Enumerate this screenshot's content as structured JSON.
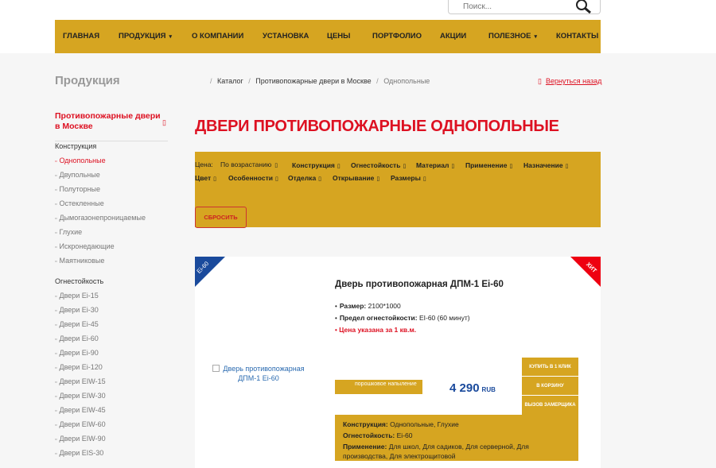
{
  "search": {
    "placeholder": "Поиск..."
  },
  "nav": {
    "items": [
      {
        "label": "ГЛАВНАЯ"
      },
      {
        "label": "ПРОДУКЦИЯ"
      },
      {
        "label": "О КОМПАНИИ"
      },
      {
        "label": "УСТАНОВКА"
      },
      {
        "label": "ЦЕНЫ"
      },
      {
        "label": "ПОРТФОЛИО"
      },
      {
        "label": "АКЦИИ"
      },
      {
        "label": "ПОЛЕЗНОЕ"
      },
      {
        "label": "КОНТАКТЫ"
      }
    ]
  },
  "sidebar": {
    "title": "Продукция",
    "category": "Противопожарные двери в Москве",
    "groups": [
      {
        "title": "Конструкция",
        "items": [
          "Однопольные",
          "Двупольные",
          "Полуторные",
          "Остекленные",
          "Дымогазонепроницаемые",
          "Глухие",
          "Искронедающие",
          "Маятниковые"
        ]
      },
      {
        "title": "Огнестойкость",
        "items": [
          "Двери Ei-15",
          "Двери Ei-30",
          "Двери Ei-45",
          "Двери Ei-60",
          "Двери Ei-90",
          "Двери Ei-120",
          "Двери EIW-15",
          "Двери EIW-30",
          "Двери EIW-45",
          "Двери EIW-60",
          "Двери EIW-90",
          "Двери EIS-30"
        ]
      }
    ]
  },
  "breadcrumb": {
    "items": [
      "Каталог",
      "Противопожарные двери в Москве",
      "Однопольные"
    ]
  },
  "back_link": "Вернуться назад",
  "heading": "ДВЕРИ ПРОТИВОПОЖАРНЫЕ ОДНОПОЛЬНЫЕ",
  "filter": {
    "price_label": "Цена:",
    "price_value": "По возрастанию",
    "row1": [
      "Конструкция",
      "Огнестойкость",
      "Материал",
      "Применение",
      "Назначение"
    ],
    "row2": [
      "Цвет",
      "Особенности",
      "Отделка",
      "Открывание",
      "Размеры"
    ],
    "reset": "СБРОСИТЬ"
  },
  "product": {
    "badge_left": "Ei-60",
    "badge_right": "ХИТ",
    "image_alt": "Дверь противопожарная ДПМ-1 Ei-60",
    "title": "Дверь противопожарная ДПМ-1 Ei-60",
    "specs": [
      {
        "label": "Размер:",
        "value": "2100*1000"
      },
      {
        "label": "Предел огнестойкости:",
        "value": "EI-60 (60 минут)"
      }
    ],
    "price_note": "Цена указана за 1 кв.м.",
    "coating": "порошковое напыление",
    "price": "4 290",
    "currency": "RUB",
    "buttons": [
      "КУПИТЬ В 1 КЛИК",
      "В КОРЗИНУ",
      "ВЫЗОВ ЗАМЕРЩИКА"
    ],
    "props": [
      {
        "k": "Конструкция:",
        "v": "Однопольные, Глухие"
      },
      {
        "k": "Огнестойкость:",
        "v": "Ei-60"
      },
      {
        "k": "Применение:",
        "v": "Для школ, Для садиков, Для серверной, Для производства, Для электрощитовой"
      }
    ]
  },
  "colors": {
    "accent": "#d6a521",
    "red": "#dd1122",
    "blue": "#1a4a9c"
  }
}
